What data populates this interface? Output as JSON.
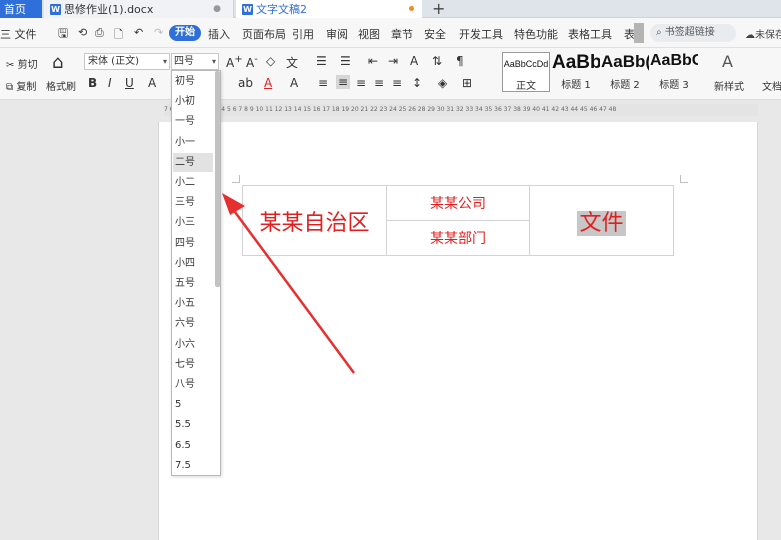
{
  "tabs": {
    "home": "首页",
    "doc1": "思修作业(1).docx",
    "doc2": "文字文稿2"
  },
  "menu": {
    "file": "三 文件",
    "start": "开始",
    "items": [
      "插入",
      "页面布局",
      "引用",
      "审阅",
      "视图",
      "章节",
      "安全",
      "开发工具",
      "特色功能",
      "表格工具",
      "表"
    ],
    "search_placeholder": "书签超链接",
    "unsaved": "未保存"
  },
  "ribbon": {
    "cut": "剪切",
    "copy": "复制",
    "format_painter": "格式刷",
    "font_name": "宋体 (正文)",
    "font_size": "四号",
    "bold": "B",
    "italic": "I",
    "underline": "U",
    "new_style": "新样式",
    "doc_tool": "文档",
    "styles": [
      {
        "sample": "AaBbCcDd",
        "name": "正文"
      },
      {
        "sample": "AaBb",
        "name": "标题 1"
      },
      {
        "sample": "AaBb(",
        "name": "标题 2"
      },
      {
        "sample": "AaBbC",
        "name": "标题 3"
      }
    ]
  },
  "ruler_text": "7 6 4 2 1 2 1 1 2 3 4 5 6 7 8 9 10 11 12 13 14 15 16 17 18 19 20 21 22 23 24 25 26 28 29 30 31 32 33 34 35 36 37 38 39 40 41 42 43 44 45 46 47 48",
  "font_size_options": [
    "初号",
    "小初",
    "一号",
    "小一",
    "二号",
    "小二",
    "三号",
    "小三",
    "四号",
    "小四",
    "五号",
    "小五",
    "六号",
    "小六",
    "七号",
    "八号",
    "5",
    "5.5",
    "6.5",
    "7.5"
  ],
  "hovered_option": "二号",
  "document": {
    "left_cell": "某某自治区",
    "top_middle": "某某公司",
    "bottom_middle": "某某部门",
    "right_cell": "文件"
  },
  "colors": {
    "accent": "#2f6fd9",
    "doc_text": "#e02020",
    "arrow": "#e53030"
  }
}
